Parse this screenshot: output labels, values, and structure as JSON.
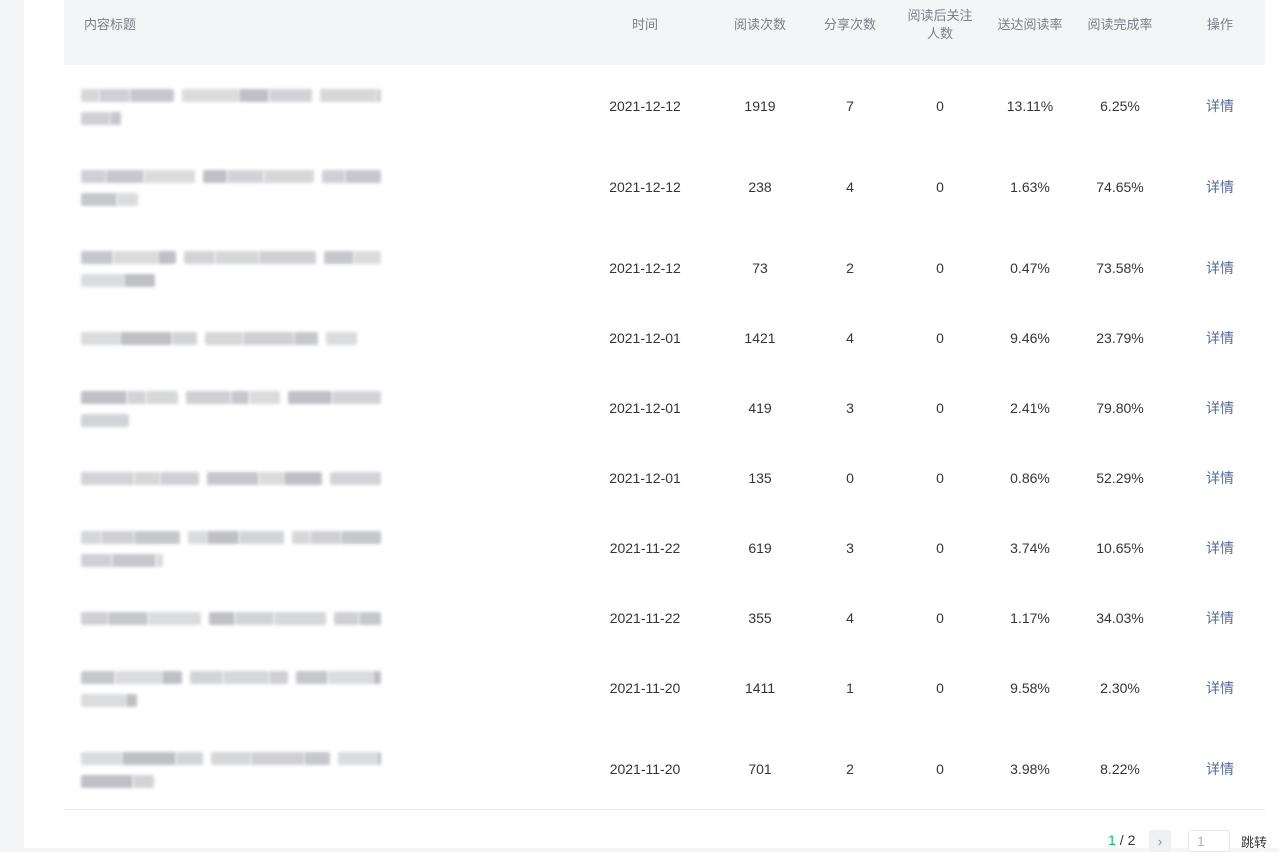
{
  "table": {
    "headers": {
      "title": "内容标题",
      "time": "时间",
      "reads": "阅读次数",
      "shares": "分享次数",
      "follows": "阅读后关注人数",
      "delivery_rate": "送达阅读率",
      "completion_rate": "阅读完成率",
      "action": "操作"
    },
    "rows": [
      {
        "time": "2021-12-12",
        "reads": "1919",
        "shares": "7",
        "follows": "0",
        "delivery_rate": "13.11%",
        "completion_rate": "6.25%",
        "action": "详情"
      },
      {
        "time": "2021-12-12",
        "reads": "238",
        "shares": "4",
        "follows": "0",
        "delivery_rate": "1.63%",
        "completion_rate": "74.65%",
        "action": "详情"
      },
      {
        "time": "2021-12-12",
        "reads": "73",
        "shares": "2",
        "follows": "0",
        "delivery_rate": "0.47%",
        "completion_rate": "73.58%",
        "action": "详情"
      },
      {
        "time": "2021-12-01",
        "reads": "1421",
        "shares": "4",
        "follows": "0",
        "delivery_rate": "9.46%",
        "completion_rate": "23.79%",
        "action": "详情"
      },
      {
        "time": "2021-12-01",
        "reads": "419",
        "shares": "3",
        "follows": "0",
        "delivery_rate": "2.41%",
        "completion_rate": "79.80%",
        "action": "详情"
      },
      {
        "time": "2021-12-01",
        "reads": "135",
        "shares": "0",
        "follows": "0",
        "delivery_rate": "0.86%",
        "completion_rate": "52.29%",
        "action": "详情"
      },
      {
        "time": "2021-11-22",
        "reads": "619",
        "shares": "3",
        "follows": "0",
        "delivery_rate": "3.74%",
        "completion_rate": "10.65%",
        "action": "详情"
      },
      {
        "time": "2021-11-22",
        "reads": "355",
        "shares": "4",
        "follows": "0",
        "delivery_rate": "1.17%",
        "completion_rate": "34.03%",
        "action": "详情"
      },
      {
        "time": "2021-11-20",
        "reads": "1411",
        "shares": "1",
        "follows": "0",
        "delivery_rate": "9.58%",
        "completion_rate": "2.30%",
        "action": "详情"
      },
      {
        "time": "2021-11-20",
        "reads": "701",
        "shares": "2",
        "follows": "0",
        "delivery_rate": "3.98%",
        "completion_rate": "8.22%",
        "action": "详情"
      }
    ]
  },
  "pagination": {
    "current": "1",
    "separator": "/ 2",
    "next_icon": "chevron-right-icon",
    "input_value": "1",
    "jump_label": "跳转"
  },
  "colors": {
    "link": "#576b95",
    "current_page": "#07c160",
    "header_bg": "#f4f5f7"
  }
}
